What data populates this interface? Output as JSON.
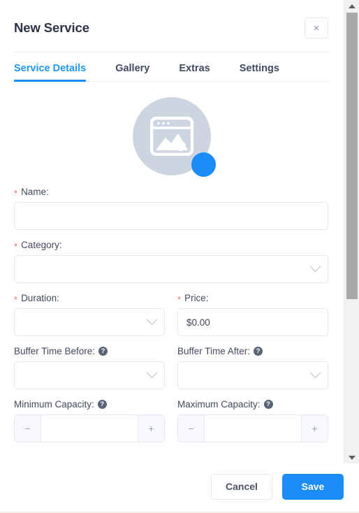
{
  "header": {
    "title": "New Service",
    "close_label": "×"
  },
  "tabs": [
    {
      "label": "Service Details",
      "active": true
    },
    {
      "label": "Gallery",
      "active": false
    },
    {
      "label": "Extras",
      "active": false
    },
    {
      "label": "Settings",
      "active": false
    }
  ],
  "avatar": {
    "icon": "image-placeholder-icon",
    "badge_icon": "add-photo-badge-icon",
    "circle_color": "#cdd5e1",
    "badge_color": "#1a8cf5"
  },
  "form": {
    "name": {
      "label": "Name:",
      "required": true,
      "value": "",
      "placeholder": ""
    },
    "category": {
      "label": "Category:",
      "required": true,
      "value": "",
      "placeholder": ""
    },
    "duration": {
      "label": "Duration:",
      "required": true,
      "value": "",
      "placeholder": ""
    },
    "price": {
      "label": "Price:",
      "required": true,
      "value": "$0.00",
      "placeholder": ""
    },
    "buffer_before": {
      "label": "Buffer Time Before:",
      "required": false,
      "help": "?",
      "value": "",
      "placeholder": ""
    },
    "buffer_after": {
      "label": "Buffer Time After:",
      "required": false,
      "help": "?",
      "value": "",
      "placeholder": ""
    },
    "min_capacity": {
      "label": "Minimum Capacity:",
      "required": false,
      "help": "?",
      "value": "",
      "minus": "−",
      "plus": "+"
    },
    "max_capacity": {
      "label": "Maximum Capacity:",
      "required": false,
      "help": "?",
      "value": "",
      "minus": "−",
      "plus": "+"
    },
    "required_marker": "*"
  },
  "footer": {
    "cancel_label": "Cancel",
    "save_label": "Save"
  },
  "colors": {
    "accent": "#1a8cf5",
    "required": "#f56a63",
    "text": "#434a5c"
  }
}
